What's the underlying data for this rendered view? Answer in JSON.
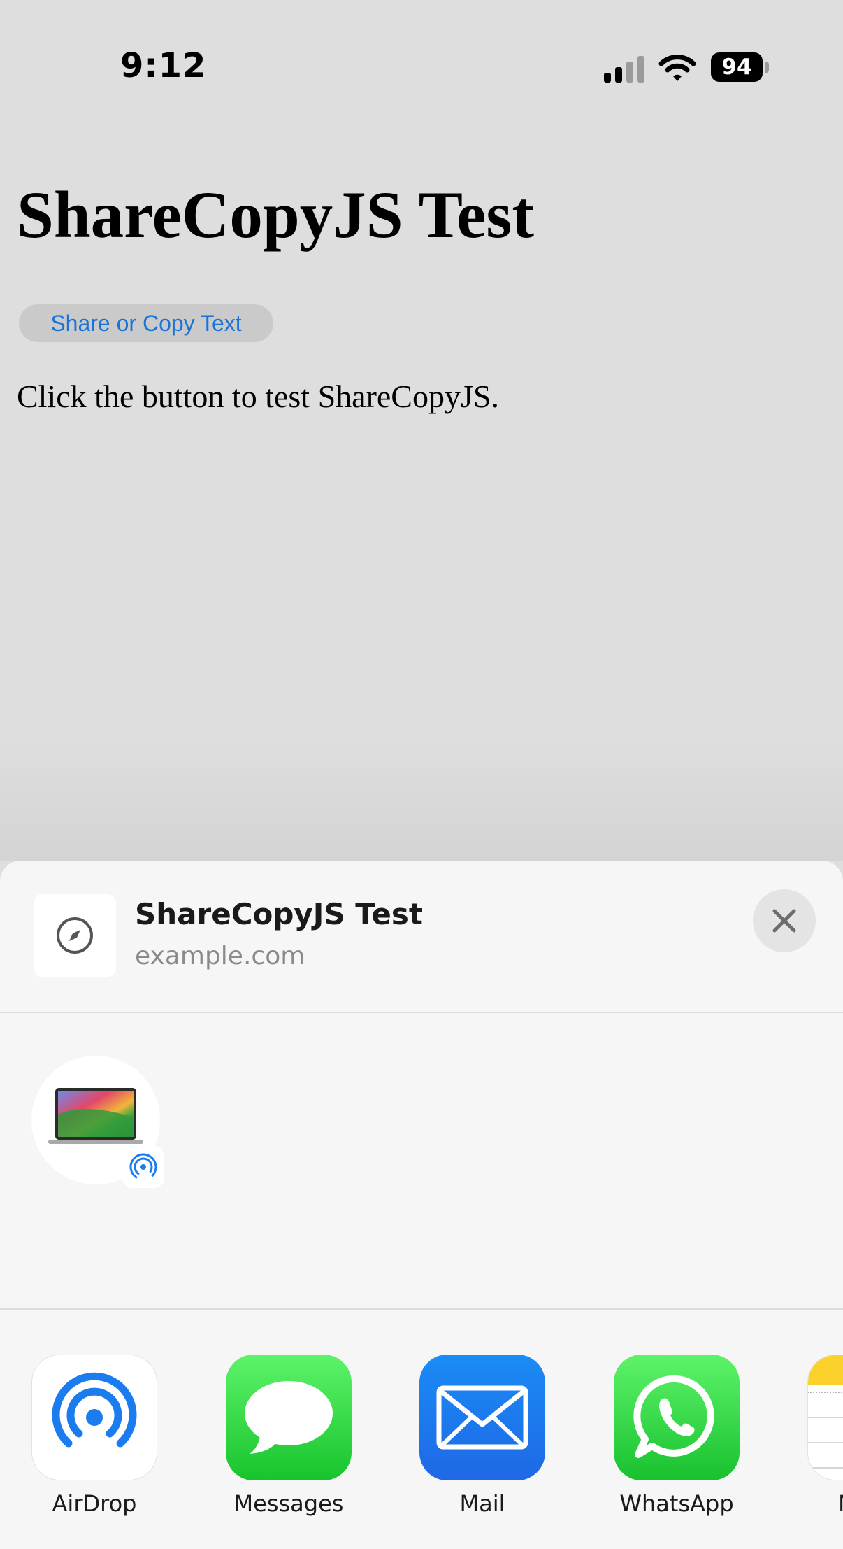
{
  "status_bar": {
    "time": "9:12",
    "battery_level": "94",
    "signal_bars_active": 2,
    "signal_bars_total": 4
  },
  "page": {
    "title": "ShareCopyJS Test",
    "button_label": "Share or Copy Text",
    "description": "Click the button to test ShareCopyJS."
  },
  "share_sheet": {
    "preview": {
      "title": "ShareCopyJS Test",
      "url": "example.com",
      "icon": "safari-compass-icon"
    },
    "close_icon": "close-icon",
    "airdrop_devices": [
      {
        "icon": "macbook-icon",
        "badge_icon": "airdrop-icon"
      }
    ],
    "apps": [
      {
        "label": "AirDrop",
        "icon": "airdrop-icon"
      },
      {
        "label": "Messages",
        "icon": "messages-icon"
      },
      {
        "label": "Mail",
        "icon": "mail-icon"
      },
      {
        "label": "WhatsApp",
        "icon": "whatsapp-icon"
      },
      {
        "label": "N",
        "icon": "notes-icon"
      }
    ]
  },
  "colors": {
    "link_blue": "#1a73d8",
    "messages_green": "#17c42c",
    "mail_blue": "#1f68e6",
    "whatsapp_green": "#18c12e"
  }
}
